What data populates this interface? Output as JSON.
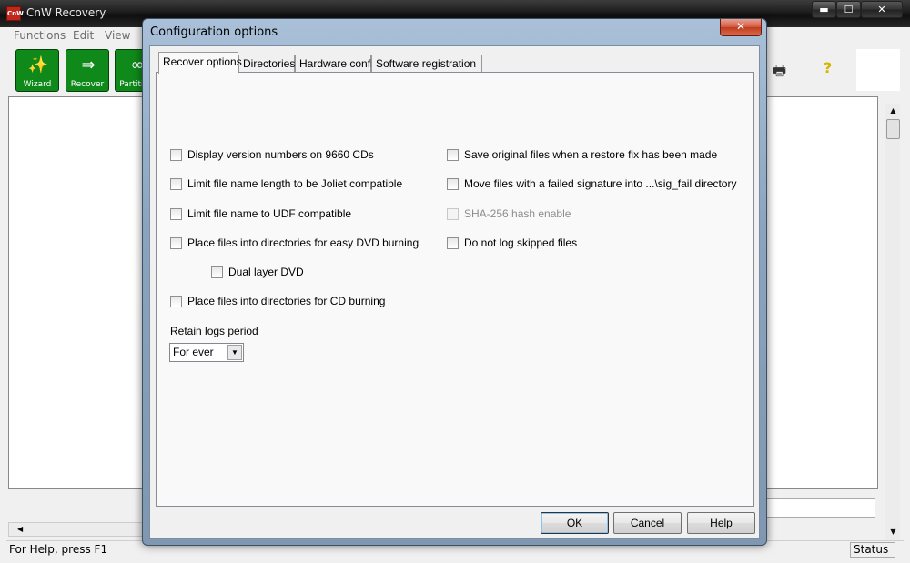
{
  "main_window": {
    "title": "CnW Recovery",
    "icon_text": "CnW",
    "caption_buttons": {
      "minimize": "▬",
      "maximize": "☐",
      "close": "✕"
    },
    "menu": [
      "Functions",
      "Edit",
      "View"
    ],
    "toolbar": [
      {
        "label": "Wizard",
        "icon": "wand-icon",
        "glyph": "✨"
      },
      {
        "label": "Recover",
        "icon": "recover-icon",
        "glyph": "⇒"
      },
      {
        "label": "Partition",
        "icon": "partition-icon",
        "glyph": "∞"
      }
    ],
    "toolbar_right": {
      "print_icon": "printer-icon",
      "print_glyph": "🖶",
      "help_icon": "help-icon",
      "help_glyph": "?"
    },
    "status_help": "For Help, press F1",
    "status_right": "Status"
  },
  "dialog": {
    "title": "Configuration options",
    "close_glyph": "✕",
    "tabs": [
      "Recover options",
      "Directories",
      "Hardware config",
      "Software registration"
    ],
    "active_tab": 0,
    "left_options": [
      {
        "label": "Display version numbers on 9660 CDs",
        "checked": false,
        "enabled": true
      },
      {
        "label": "Limit file name length to be Joliet compatible",
        "checked": false,
        "enabled": true
      },
      {
        "label": "Limit file name to UDF compatible",
        "checked": false,
        "enabled": true
      },
      {
        "label": "Place files into directories for easy DVD burning",
        "checked": false,
        "enabled": true
      },
      {
        "label": "Dual layer DVD",
        "checked": false,
        "enabled": true
      },
      {
        "label": "Place files into directories for CD burning",
        "checked": false,
        "enabled": true
      }
    ],
    "right_options": [
      {
        "label": "Save original files when a restore fix has been made",
        "checked": false,
        "enabled": true
      },
      {
        "label": "Move files with a failed signature into ...\\sig_fail directory",
        "checked": false,
        "enabled": true
      },
      {
        "label": "SHA-256 hash enable",
        "checked": false,
        "enabled": false
      },
      {
        "label": "Do not log skipped files",
        "checked": false,
        "enabled": true
      }
    ],
    "retain_logs": {
      "label": "Retain logs period",
      "value": "For ever"
    },
    "buttons": {
      "ok": "OK",
      "cancel": "Cancel",
      "help": "Help"
    }
  }
}
